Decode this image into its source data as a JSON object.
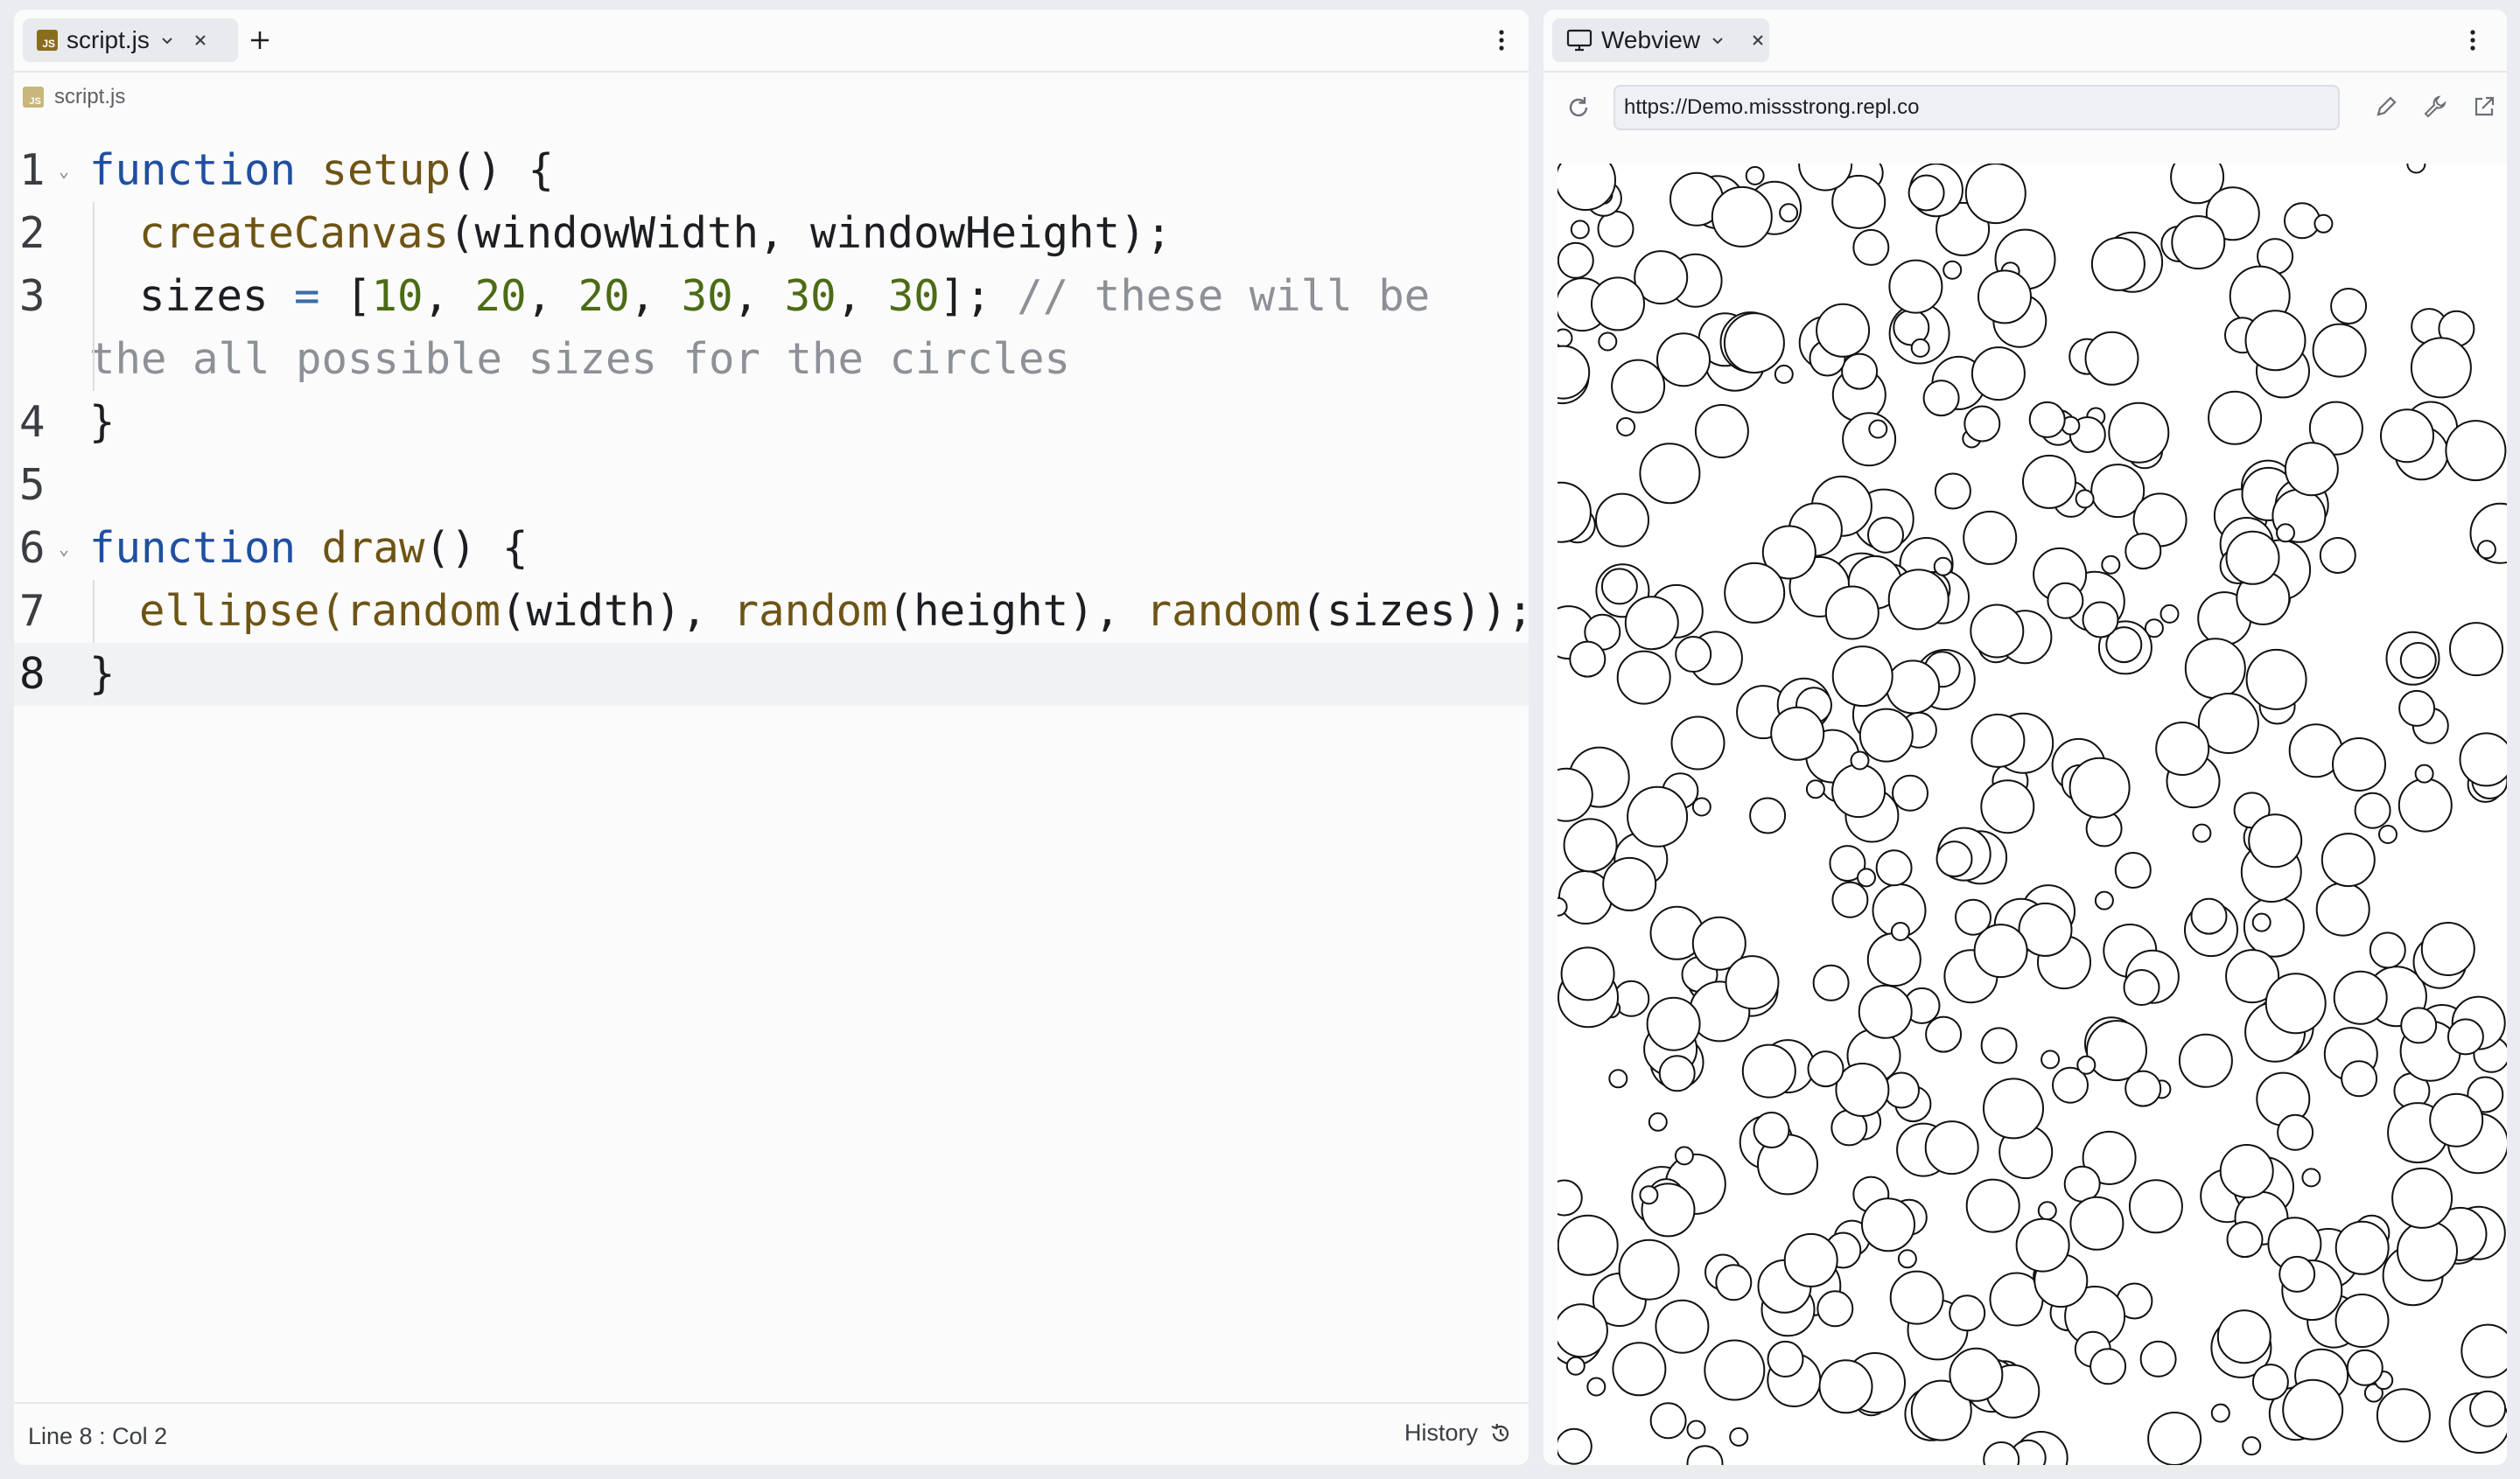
{
  "editor": {
    "tab_label": "script.js",
    "breadcrumb": "script.js",
    "lines": [
      {
        "n": "1"
      },
      {
        "n": "2"
      },
      {
        "n": "3"
      },
      {
        "n": "4"
      },
      {
        "n": "5"
      },
      {
        "n": "6"
      },
      {
        "n": "7"
      },
      {
        "n": "8"
      }
    ],
    "code": {
      "l1_kw": "function",
      "l1_fn": "setup",
      "l1_rest": "() {",
      "l2_fn": "createCanvas",
      "l2_rest": "(windowWidth, windowHeight);",
      "l3_var": "sizes ",
      "l3_op": "=",
      "l3_open": " [",
      "l3_n1": "10",
      "l3_n2": "20",
      "l3_n3": "20",
      "l3_n4": "30",
      "l3_n5": "30",
      "l3_n6": "30",
      "l3_close": "]; ",
      "l3_comment_a": "// these will be",
      "l3_comment_b": "the all possible sizes for the circles",
      "l4": "}",
      "l6_kw": "function",
      "l6_fn": "draw",
      "l6_rest": "() {",
      "l7_fn1": "ellipse",
      "l7_p1": "(",
      "l7_fn2": "random",
      "l7_p2": "(width), ",
      "l7_fn3": "random",
      "l7_p3": "(height), ",
      "l7_fn4": "random",
      "l7_p4": "(sizes));",
      "l8": "}"
    },
    "status": {
      "position": "Line 8 : Col 2",
      "history": "History"
    }
  },
  "webview": {
    "tab_label": "Webview",
    "url": "https://Demo.missstrong.repl.co"
  },
  "colors": {
    "keyword": "#1f4fa0",
    "function": "#6e5414",
    "number": "#4b6b15",
    "comment": "#8d9096"
  }
}
